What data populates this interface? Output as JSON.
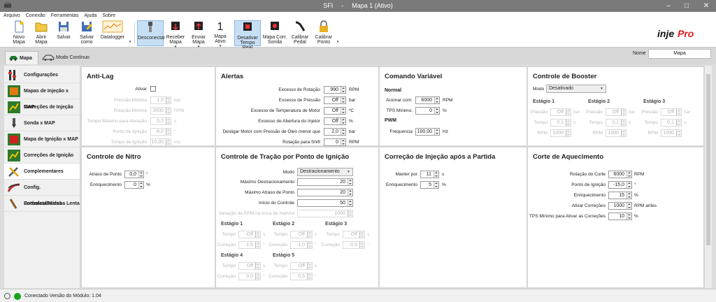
{
  "window": {
    "title": "SFI",
    "separator": "-",
    "doc_title": "Mapa 1 (Ativo)"
  },
  "menu": [
    "Arquivo",
    "Conexão",
    "Ferramentas",
    "Ajuda",
    "Sobre"
  ],
  "toolbar": {
    "novo": "Novo Mapa",
    "abrir": "Abrir Mapa",
    "salvar": "Salvar",
    "salvar_como": "Salvar como",
    "datalogger": "Datalogger",
    "desconectar": "Desconectar",
    "receber": "Receber Mapa",
    "enviar": "Enviar Mapa",
    "mapa_ativo_num": "1",
    "mapa_ativo": "Mapa Ativo",
    "desativar": "Desativar Tempo Real",
    "mapa_corr": "Mapa Corr. Sonda",
    "calibrar_pedal": "Calibrar Pedal",
    "calibrar_ponto": "Calibrar Ponto"
  },
  "tabs": {
    "mapa": "Mapa",
    "modo": "Modo Contínuo"
  },
  "name": {
    "label": "Nome",
    "value": "Mapa"
  },
  "sidebar": [
    "Configurações",
    "Mapas de Injeção x MAP",
    "Correções de Injeção",
    "Sonda x MAP",
    "Mapa de Ignição x MAP",
    "Correções de Ignição",
    "Complementares",
    "Config. Entradas/Saídas",
    "Borboleta/Marcha Lenta"
  ],
  "antilag": {
    "title": "Anti-Lag",
    "ativar": "Ativar",
    "rows": [
      {
        "label": "Pressão Mínima",
        "value": "1,0",
        "unit": "bar"
      },
      {
        "label": "Rotação Mínima",
        "value": "3000",
        "unit": "RPM"
      },
      {
        "label": "Tempo Máximo para Ativação",
        "value": "0,0",
        "unit": "s"
      },
      {
        "label": "Ponto de Ignição",
        "value": "-8,0",
        "unit": "°"
      },
      {
        "label": "Tempo de Ignição",
        "value": "10,00",
        "unit": "ms"
      }
    ]
  },
  "alertas": {
    "title": "Alertas",
    "rows": [
      {
        "label": "Excesso de Rotação",
        "value": "990",
        "unit": "RPM"
      },
      {
        "label": "Excesso de Pressão",
        "value": "Off",
        "unit": "bar"
      },
      {
        "label": "Excesso de Temperatura de Motor",
        "value": "Off",
        "unit": "ºC"
      },
      {
        "label": "Excesso de Abertura do Injetor",
        "value": "Off",
        "unit": "%"
      },
      {
        "label": "Desligar Motor com Pressão de Óleo menor que",
        "value": "2,0",
        "unit": "bar"
      },
      {
        "label": "Rotação para Shift",
        "value": "0",
        "unit": "RPM"
      }
    ]
  },
  "comando": {
    "title": "Comando Variável",
    "normal": "Normal",
    "pwm": "PWM",
    "acionar_label": "Acionar com:",
    "acionar_value": "6000",
    "acionar_unit": "RPM",
    "tps_label": "TPS Mínimo:",
    "tps_value": "0",
    "tps_unit": "%",
    "freq_label": "Frequencia",
    "freq_value": "100,00",
    "freq_unit": "Hz"
  },
  "booster": {
    "title": "Controle de Booster",
    "modo_label": "Modo",
    "modo_value": "Desativado",
    "stages": [
      "Estágio 1",
      "Estágio 2",
      "Estágio 3"
    ],
    "pressao_label": "Pressão",
    "tempo_label": "Tempo",
    "rpm_label": "RPM",
    "pressao": "Off",
    "pressao_unit": "bar",
    "tempo": "0,1",
    "tempo_unit": "s",
    "rpm": "1000"
  },
  "nitro": {
    "title": "Controle de Nitro",
    "atraso_label": "Atraso de Ponto",
    "atraso_value": "0,0",
    "atraso_unit": "°",
    "enriq_label": "Enriquecimento",
    "enriq_value": "0",
    "enriq_unit": "%"
  },
  "tracao": {
    "title": "Controle de Tração por Ponto de Ignição",
    "modo_label": "Modo",
    "modo_value": "Destracionamento",
    "rows": [
      {
        "label": "Máximo Destracionamento",
        "value": "20"
      },
      {
        "label": "Máximo Atraso de Ponto",
        "value": "20"
      },
      {
        "label": "Início do Controle",
        "value": "50"
      },
      {
        "label": "Variação de RPM na troca de marcha",
        "value": "1000"
      }
    ],
    "stages": [
      "Estágio 1",
      "Estágio 2",
      "Estágio 3",
      "Estágio 4",
      "Estágio 5"
    ],
    "tempo_label": "Tempo",
    "correcao_label": "Correção",
    "tempo": "Off",
    "tempo_unit": "s",
    "corr": [
      "-1,5",
      "-1,0",
      "-0,5",
      "0,0",
      "0,5"
    ],
    "corr_unit": "°"
  },
  "correcao_partida": {
    "title": "Correção de Injeção após a Partida",
    "manter_label": "Manter por",
    "manter_value": "11",
    "manter_unit": "s",
    "enriq_label": "Enriquecimento",
    "enriq_value": "5",
    "enriq_unit": "%"
  },
  "aquecimento": {
    "title": "Corte de Aquecimento",
    "rows": [
      {
        "label": "Rotação do Corte",
        "value": "6000",
        "unit": "RPM"
      },
      {
        "label": "Ponto de Ignição",
        "value": "-15,0",
        "unit": "°"
      },
      {
        "label": "Enriquecimento",
        "value": "15",
        "unit": "%"
      },
      {
        "label": "Ativar Correções",
        "value": "1000",
        "unit": "RPM antes"
      },
      {
        "label": "TPS Mínimo para Ativar as Correções",
        "value": "10",
        "unit": "%"
      }
    ]
  },
  "status": {
    "text": "Conectado Versão do Módulo: 1.04",
    "color": "#1aa31a"
  }
}
